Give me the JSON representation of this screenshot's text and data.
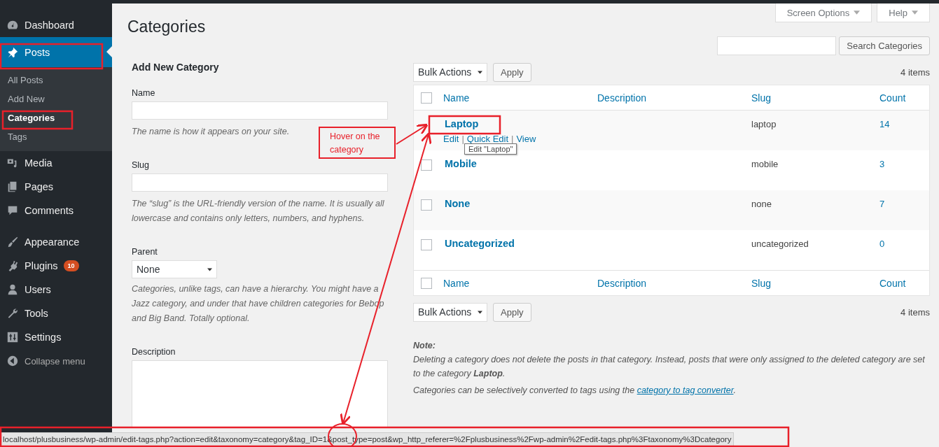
{
  "sidebar": {
    "items": [
      {
        "label": "Dashboard",
        "selected": false
      },
      {
        "label": "Posts",
        "selected": true,
        "children": [
          {
            "label": "All Posts",
            "selected": false
          },
          {
            "label": "Add New",
            "selected": false
          },
          {
            "label": "Categories",
            "selected": true
          },
          {
            "label": "Tags",
            "selected": false
          }
        ]
      },
      {
        "label": "Media",
        "selected": false
      },
      {
        "label": "Pages",
        "selected": false
      },
      {
        "label": "Comments",
        "selected": false
      },
      {
        "label": "Appearance",
        "selected": false
      },
      {
        "label": "Plugins",
        "selected": false,
        "badge": "10"
      },
      {
        "label": "Users",
        "selected": false
      },
      {
        "label": "Tools",
        "selected": false
      },
      {
        "label": "Settings",
        "selected": false
      }
    ],
    "collapse_label": "Collapse menu"
  },
  "header": {
    "title": "Categories",
    "tabs": [
      "Screen Options",
      "Help"
    ]
  },
  "search": {
    "button": "Search Categories"
  },
  "form": {
    "heading": "Add New Category",
    "fields": [
      {
        "kind": "text",
        "label": "Name",
        "help": "The name is how it appears on your site."
      },
      {
        "kind": "text",
        "label": "Slug",
        "help": "The “slug” is the URL-friendly version of the name. It is usually all lowercase and contains only letters, numbers, and hyphens."
      },
      {
        "kind": "select",
        "label": "Parent",
        "value": "None",
        "help": "Categories, unlike tags, can have a hierarchy. You might have a Jazz category, and under that have children categories for Bebop and Big Band. Totally optional."
      },
      {
        "kind": "textarea",
        "label": "Description"
      }
    ]
  },
  "table": {
    "top_bar": {
      "bulk_action": "Bulk Actions",
      "apply": "Apply",
      "count": "4 items"
    },
    "header": {
      "all_checked": false,
      "columns": [
        "Name",
        "Description",
        "Slug",
        "Count"
      ]
    },
    "rows": [
      {
        "name": "Laptop",
        "slug": "laptop",
        "count": "14",
        "actions": [
          {
            "label": "Edit"
          },
          {
            "separator": "|",
            "label": "Quick Edit"
          },
          {
            "separator": "|",
            "label": "View"
          }
        ]
      },
      {
        "name": "Mobile",
        "slug": "mobile",
        "count": "3",
        "checked": false
      },
      {
        "name": "None",
        "slug": "none",
        "count": "7",
        "checked": false
      },
      {
        "name": "Uncategorized",
        "slug": "uncategorized",
        "count": "0",
        "checked": false
      }
    ],
    "footer": {
      "all_checked": false,
      "columns": [
        "Name",
        "Description",
        "Slug",
        "Count"
      ]
    },
    "bottom_bar": {
      "bulk_action": "Bulk Actions",
      "apply": "Apply",
      "count": "4 items"
    },
    "tooltip": "Edit \"Laptop\""
  },
  "note": {
    "heading": "Note:",
    "text": "Deleting a category does not delete the posts in that category. Instead, posts that were only assigned to the deleted category are set to the category **Laptop**.",
    "converter_text": "Categories can be selectively converted to tags using the",
    "converter_link": "category to tag converter",
    "converter_end": "."
  },
  "status_bar": {
    "url": "localhost/plusbusiness/wp-admin/edit-tags.php?action=edit&taxonomy=category&tag_ID=1&post_type=post&wp_http_referer=%2Fplusbusiness%2Fwp-admin%2Fedit-tags.php%3Ftaxonomy%3Dcategory"
  },
  "annotation": {
    "callout": "Hover on the category"
  }
}
